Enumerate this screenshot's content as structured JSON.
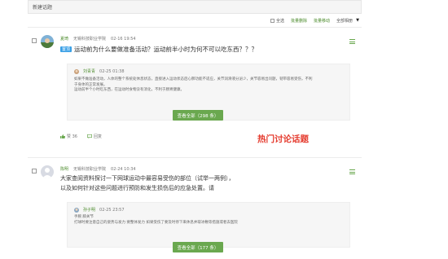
{
  "topbar": {
    "new_topic": "新建话题"
  },
  "toolbar": {
    "select_all": "全选",
    "batch_delete": "批量删除",
    "batch_move": "批量移动",
    "filter_label": "全部相册"
  },
  "posts": [
    {
      "author": "夏琦",
      "school": "无锡科技职业学院",
      "time": "02-16 19:54",
      "tag": "置顶",
      "question": "运动前为什么要做准备活动？运动前半小时为何不可以吃东西？？？",
      "reply": {
        "author": "刘青青",
        "time": "02-25 01:38",
        "lines": [
          "如果不做准备活动，人体的整个系统处休息状态，直接进入运动状态后心肺功能不适应，关节润滑液分泌少，关节容易出问题，韧带容易受伤，不利",
          "于身体的正常发展。",
          "运动前半个小时吃东西，在运动时食物没有消化，不利于肠胃健康。"
        ]
      },
      "view_all": "查看全部（298 条）",
      "like": "赞 36",
      "reply_action": "回复"
    },
    {
      "author": "陈明",
      "school": "无锡科技职业学院",
      "time": "02-24 10:34",
      "question_lines": [
        "大家查阅资料探讨一下网球运动中最容易受伤的部位（试举一两例），",
        "以及如何针对这些问题进行预防和发生损伤后的应急处置。请"
      ],
      "reply": {
        "author": "孙子明",
        "time": "02-25 23:57",
        "lines": [
          "手腕 膝关节",
          "打球时要注意自己的姿势与发力 要整体发力 如果受伤了要及时停下来休息并取冰敷等措施或者去医院"
        ]
      },
      "view_all": "查看全部（177 条）"
    }
  ],
  "annotation": "热门讨论话题",
  "colors": {
    "accent": "#6aa84f",
    "annotation": "#e53c2f",
    "tag": "#3aa0e6"
  }
}
